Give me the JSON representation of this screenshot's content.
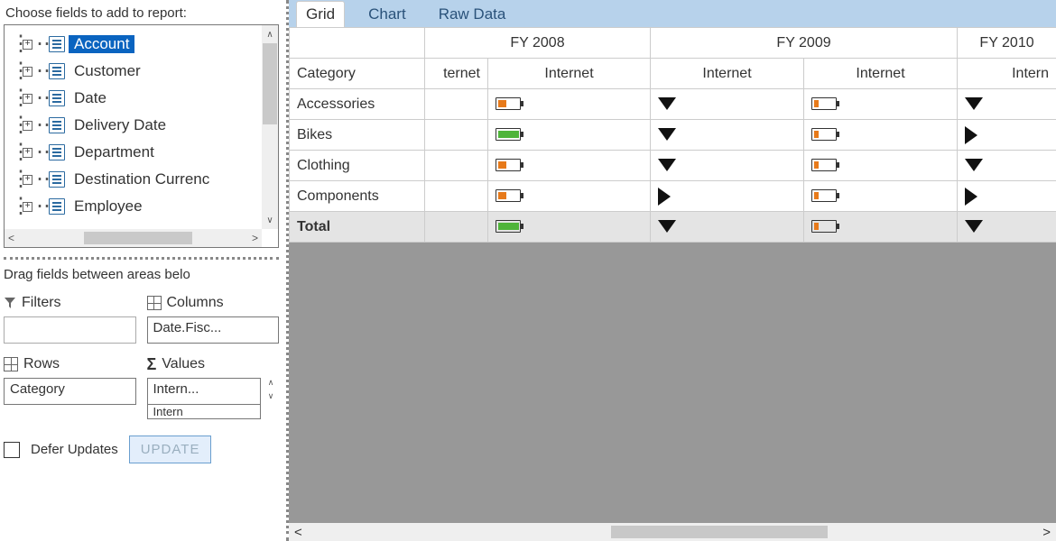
{
  "left": {
    "chooser_label": "Choose fields to add to report:",
    "fields": [
      {
        "label": "Account",
        "selected": true
      },
      {
        "label": "Customer",
        "selected": false
      },
      {
        "label": "Date",
        "selected": false
      },
      {
        "label": "Delivery Date",
        "selected": false
      },
      {
        "label": "Department",
        "selected": false
      },
      {
        "label": "Destination Currenc",
        "selected": false
      },
      {
        "label": "Employee",
        "selected": false
      }
    ],
    "drag_label": "Drag fields between areas belo",
    "areas": {
      "filters": {
        "header": "Filters"
      },
      "columns": {
        "header": "Columns",
        "item": "Date.Fisc..."
      },
      "rows": {
        "header": "Rows",
        "item": "Category"
      },
      "values": {
        "header": "Values",
        "item1": "Intern...",
        "item2": "Intern"
      }
    },
    "footer": {
      "defer_label": "Defer Updates",
      "update_label": "UPDATE"
    }
  },
  "tabs": [
    "Grid",
    "Chart",
    "Raw Data"
  ],
  "grid": {
    "year_headers": [
      "FY 2008",
      "FY 2009",
      "FY 2010"
    ],
    "col_sub": [
      "ternet",
      "Internet",
      "Internet",
      "Internet",
      "Intern"
    ],
    "category_header": "Category",
    "rows": [
      {
        "label": "Accessories",
        "cells": [
          {
            "t": "empty"
          },
          {
            "t": "bar",
            "fill": "orange"
          },
          {
            "t": "trend",
            "dir": "down"
          },
          {
            "t": "bar",
            "fill": "orange-low"
          },
          {
            "t": "trend",
            "dir": "down"
          }
        ]
      },
      {
        "label": "Bikes",
        "cells": [
          {
            "t": "empty"
          },
          {
            "t": "bar",
            "fill": "green"
          },
          {
            "t": "trend",
            "dir": "down"
          },
          {
            "t": "bar",
            "fill": "orange-low"
          },
          {
            "t": "trend",
            "dir": "right"
          }
        ]
      },
      {
        "label": "Clothing",
        "cells": [
          {
            "t": "empty"
          },
          {
            "t": "bar",
            "fill": "orange"
          },
          {
            "t": "trend",
            "dir": "down"
          },
          {
            "t": "bar",
            "fill": "orange-low"
          },
          {
            "t": "trend",
            "dir": "down"
          }
        ]
      },
      {
        "label": "Components",
        "cells": [
          {
            "t": "empty"
          },
          {
            "t": "bar",
            "fill": "orange"
          },
          {
            "t": "trend",
            "dir": "right"
          },
          {
            "t": "bar",
            "fill": "orange-low"
          },
          {
            "t": "trend",
            "dir": "right"
          }
        ]
      }
    ],
    "total_label": "Total",
    "total_cells": [
      {
        "t": "empty"
      },
      {
        "t": "bar",
        "fill": "green"
      },
      {
        "t": "trend",
        "dir": "down"
      },
      {
        "t": "bar",
        "fill": "orange-low"
      },
      {
        "t": "trend",
        "dir": "down"
      }
    ]
  }
}
